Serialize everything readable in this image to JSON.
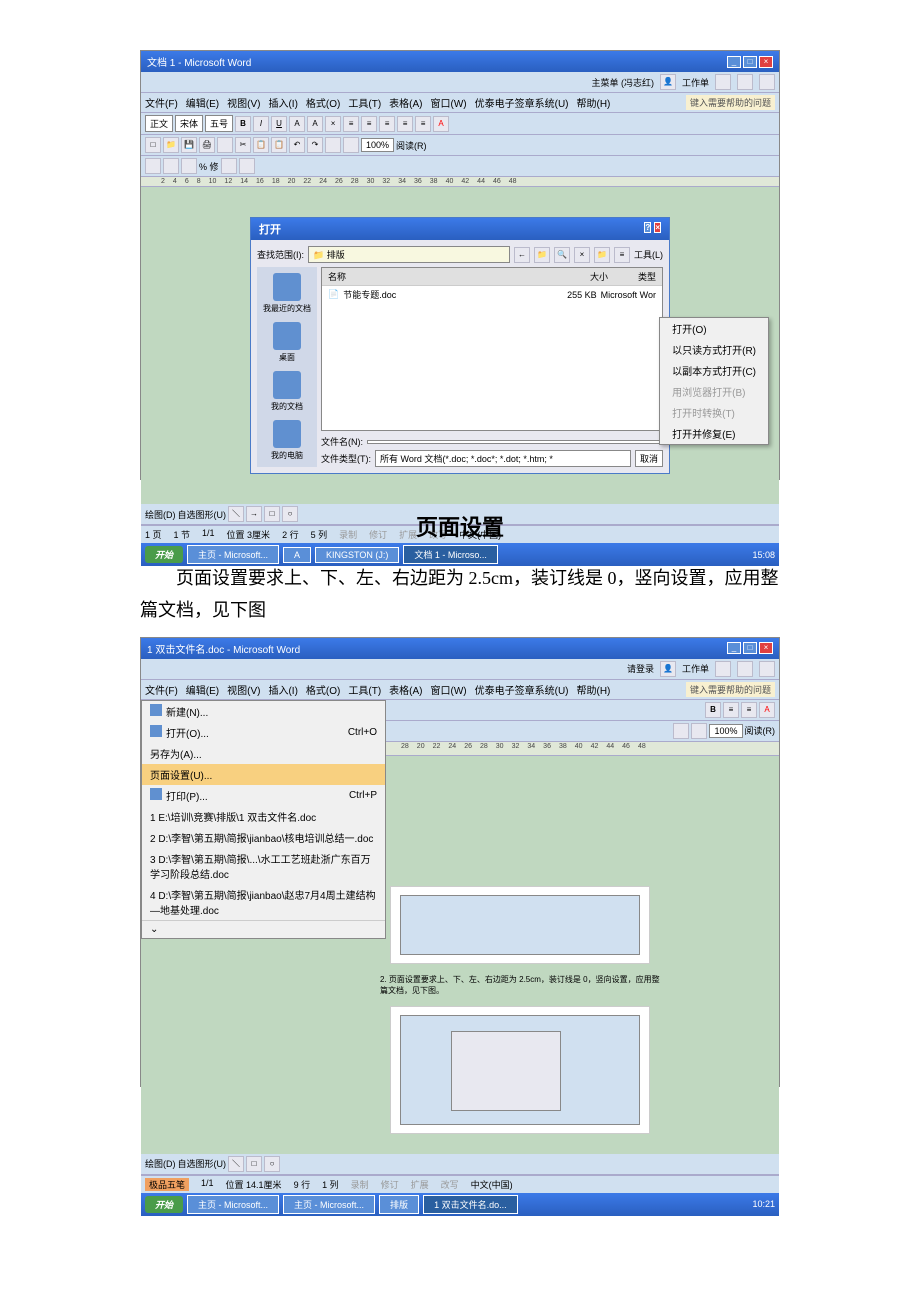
{
  "heading": "页面设置",
  "paragraph": "页面设置要求上、下、左、右边距为 2.5cm，装订线是 0，竖向设置，应用整篇文档，见下图",
  "screenshot1": {
    "title": "文档 1 - Microsoft Word",
    "task_row": {
      "main_menu": "主菜单 (冯志红)",
      "work_order": "工作单"
    },
    "menu": [
      "文件(F)",
      "编辑(E)",
      "视图(V)",
      "插入(I)",
      "格式(O)",
      "工具(T)",
      "表格(A)",
      "窗口(W)",
      "优泰电子签章系统(U)",
      "帮助(H)"
    ],
    "help_hint": "键入需要帮助的问题",
    "toolbar2": {
      "font_label": "正文",
      "font_name": "宋体",
      "font_size": "五号",
      "zoom": "100%",
      "read_label": "阅读(R)"
    },
    "ruler_marks": [
      "2",
      "4",
      "6",
      "8",
      "10",
      "12",
      "14",
      "16",
      "18",
      "20",
      "22",
      "24",
      "26",
      "28",
      "30",
      "32",
      "34",
      "36",
      "38",
      "40",
      "42",
      "44",
      "46",
      "48"
    ],
    "dialog": {
      "title": "打开",
      "lookin_label": "查找范围(I):",
      "lookin_value": "排版",
      "toolbar_label": "工具(L)",
      "places": [
        "我最近的文档",
        "桌面",
        "我的文档",
        "我的电脑"
      ],
      "columns": {
        "name": "名称",
        "size": "大小",
        "type": "类型"
      },
      "file_row": {
        "name": "节能专题.doc",
        "size": "255 KB",
        "type": "Microsoft Wor"
      },
      "filename_label": "文件名(N):",
      "filetype_label": "文件类型(T):",
      "filetype_value": "所有 Word 文档(*.doc; *.doc*; *.dot; *.htm; *",
      "cancel_btn": "取消",
      "context_menu": [
        "打开(O)",
        "以只读方式打开(R)",
        "以副本方式打开(C)",
        "用浏览器打开(B)",
        "打开时转换(T)",
        "打开并修复(E)"
      ]
    },
    "status": {
      "page": "1 页",
      "section": "1 节",
      "pages": "1/1",
      "position": "位置 3厘米",
      "line": "2 行",
      "col": "5 列",
      "rec": "录制",
      "rev": "修订",
      "ext": "扩展",
      "ovr": "改写",
      "lang": "中文(中国)"
    },
    "drawing_label": "绘图(D)",
    "autoshapes": "自选图形(U)",
    "taskbar": {
      "start": "开始",
      "items": [
        "主页 - Microsoft...",
        "A",
        "KINGSTON (J:)",
        "文档 1 - Microso..."
      ],
      "time": "15:08"
    }
  },
  "screenshot2": {
    "title": "1 双击文件名.doc - Microsoft Word",
    "task_row": {
      "login": "请登录",
      "work_order": "工作单"
    },
    "menu": [
      "文件(F)",
      "编辑(E)",
      "视图(V)",
      "插入(I)",
      "格式(O)",
      "工具(T)",
      "表格(A)",
      "窗口(W)",
      "优泰电子签章系统(U)",
      "帮助(H)"
    ],
    "help_hint": "键入需要帮助的问题",
    "toolbar2": {
      "zoom": "100%",
      "read_label": "阅读(R)"
    },
    "file_menu": {
      "new": "新建(N)...",
      "open": "打开(O)...",
      "open_shortcut": "Ctrl+O",
      "saveas": "另存为(A)...",
      "pagesetup": "页面设置(U)...",
      "print": "打印(P)...",
      "print_shortcut": "Ctrl+P",
      "recent": [
        "1 E:\\培训\\竞赛\\排版\\1 双击文件名.doc",
        "2 D:\\李智\\第五期\\简报\\jianbao\\核电培训总结一.doc",
        "3 D:\\李智\\第五期\\简报\\...\\水工工艺班赴浙广东百万学习阶段总结.doc",
        "4 D:\\李智\\第五期\\简报\\jianbao\\赵忠7月4周土建结构—地基处理.doc"
      ]
    },
    "ruler_marks": [
      "28",
      "20",
      "22",
      "24",
      "26",
      "28",
      "30",
      "32",
      "34",
      "36",
      "38",
      "40",
      "42",
      "44",
      "46",
      "48"
    ],
    "doc_text": "2. 页面设置要求上、下、左、右边距为 2.5cm，装订线是 0，竖向设置，应用整篇文档，见下图。",
    "status": {
      "pages": "1/1",
      "position": "位置 14.1厘米",
      "line": "9 行",
      "col": "1 列",
      "rec": "录制",
      "rev": "修订",
      "ext": "扩展",
      "ovr": "改写",
      "lang": "中文(中国)"
    },
    "drawing_label": "绘图(D)",
    "autoshapes": "自选图形(U)",
    "ime": "极品五笔",
    "taskbar": {
      "start": "开始",
      "items": [
        "主页 - Microsoft...",
        "主页 - Microsoft...",
        "排版",
        "1 双击文件名.do..."
      ],
      "time": "10:21"
    }
  }
}
